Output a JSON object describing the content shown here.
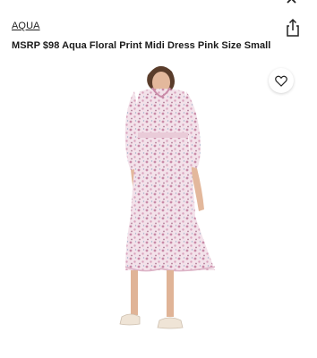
{
  "product": {
    "brand": "AQUA",
    "title": "MSRP $98 Aqua Floral Print Midi Dress Pink Size Small"
  },
  "icons": {
    "close": "close-icon",
    "share": "share-icon",
    "favorite": "heart-icon"
  },
  "colors": {
    "text": "#1a1a1a",
    "dress_base": "#f2dde6",
    "dress_flower": "#c98aa8"
  }
}
